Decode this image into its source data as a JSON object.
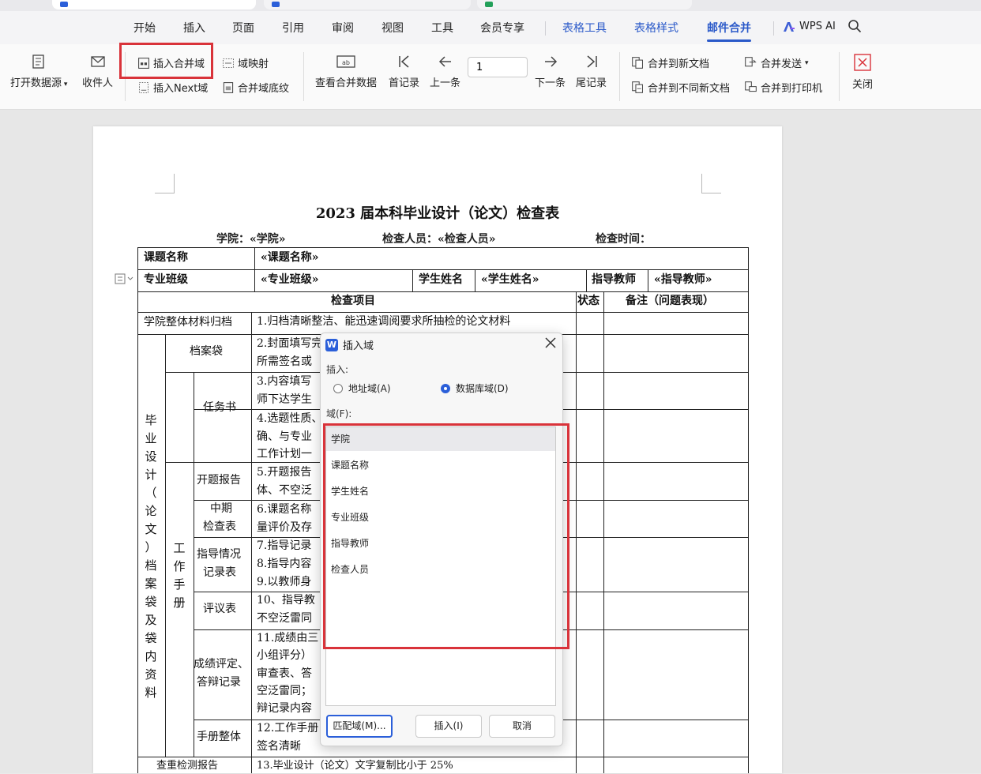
{
  "menu": {
    "tabs": [
      "开始",
      "插入",
      "页面",
      "引用",
      "审阅",
      "视图",
      "工具",
      "会员专享"
    ],
    "tool_tabs": [
      "表格工具",
      "表格样式"
    ],
    "active_tab": "邮件合并",
    "ai_label": "WPS AI"
  },
  "ribbon": {
    "open_source": "打开数据源",
    "recipients": "收件人",
    "insert_merge_field": "插入合并域",
    "field_mapping": "域映射",
    "insert_next_field": "插入Next域",
    "merge_field_shading": "合并域底纹",
    "view_merged_data": "查看合并数据",
    "first_record": "首记录",
    "prev_record": "上一条",
    "record_number": "1",
    "next_record": "下一条",
    "last_record": "尾记录",
    "merge_new_doc": "合并到新文档",
    "merge_send": "合并发送",
    "merge_diff_docs": "合并到不同新文档",
    "merge_printer": "合并到打印机",
    "close": "关闭",
    "accent_color": "#2a59c9",
    "highlight_color": "#d9333a"
  },
  "document": {
    "title": "2023 届本科毕业设计（论文）检查表",
    "info": {
      "college": "学院：«学院»",
      "inspector": "检查人员：«检查人员»",
      "check_time": "检查时间："
    },
    "table": {
      "topic_label": "课题名称",
      "topic_value": "«课题名称»",
      "class_label": "专业班级",
      "class_value": "«专业班级»",
      "student_label": "学生姓名",
      "student_value": "«学生姓名»",
      "advisor_label": "指导教师",
      "advisor_value": "«指导教师»",
      "header_item": "检查项目",
      "header_status": "状态",
      "header_remark": "备注（问题表现）",
      "college_material": "学院整体材料归档",
      "row1": "1.归档清晰整洁、能迅速调阅要求所抽检的论文材料",
      "group_vertical": "毕业设计（论文）档案袋及袋内资料",
      "file_bag": "档案袋",
      "row2a": "2.封面填写完",
      "row2b": "所需签名或",
      "workbook_vertical": "工作手册",
      "task_book": "任务书",
      "row3a": "3.内容填写",
      "row3b": "师下达学生",
      "row4a": "4.选题性质、",
      "row4b": "确、与专业",
      "row4c": "工作计划一",
      "opening_report": "开题报告",
      "row5a": "5.开题报告",
      "row5b": "体、不空泛",
      "midterm_a": "中期",
      "midterm_b": "检查表",
      "row6a": "6.课题名称",
      "row6b": "量评价及存",
      "guidance_a": "指导情况",
      "guidance_b": "记录表",
      "row7": "7.指导记录",
      "row8": "8.指导内容",
      "row9": "9.以教师身",
      "review_form": "评议表",
      "row10a": "10、指导教",
      "row10b": "不空泛雷同",
      "grading_a": "成绩评定、",
      "grading_b": "答辩记录",
      "row11a": "11.成绩由三",
      "row11b": "小组评分）",
      "row11c": "审查表、答",
      "row11d": "空泛雷同；",
      "row11e": "辩记录内容",
      "workbook_whole": "手册整体",
      "row12a": "12.工作手册",
      "row12b": "签名清晰",
      "plagiarism": "查重检测报告",
      "row13": "13.毕业设计（论文）文字复制比小于 25%"
    }
  },
  "dialog": {
    "title": "插入域",
    "insert_label": "插入:",
    "radio_address": "地址域(A)",
    "radio_database": "数据库域(D)",
    "selected_radio": "database",
    "fields_label": "域(F):",
    "fields": [
      "学院",
      "课题名称",
      "学生姓名",
      "专业班级",
      "指导教师",
      "检查人员"
    ],
    "selected_field": "学院",
    "match_button": "匹配域(M)...",
    "insert_button": "插入(I)",
    "cancel_button": "取消"
  }
}
